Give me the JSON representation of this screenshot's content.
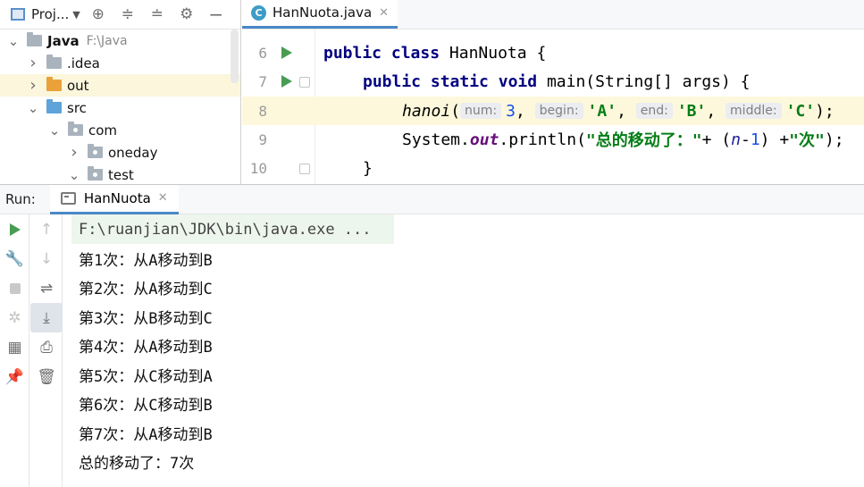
{
  "project": {
    "title": "Proj...",
    "tree": [
      {
        "label": "Java",
        "path": "F:\\Java",
        "bold": true,
        "chevron": "down",
        "folder": "grey",
        "level": 0
      },
      {
        "label": ".idea",
        "path": "",
        "chevron": "right",
        "folder": "grey",
        "level": 1
      },
      {
        "label": "out",
        "path": "",
        "chevron": "right",
        "folder": "orange",
        "level": 1,
        "highlight": true
      },
      {
        "label": "src",
        "path": "",
        "chevron": "down",
        "folder": "blue",
        "level": 1
      },
      {
        "label": "com",
        "path": "",
        "chevron": "down",
        "folder": "grey-pkg",
        "level": 2
      },
      {
        "label": "oneday",
        "path": "",
        "chevron": "right",
        "folder": "grey-pkg",
        "level": 3
      },
      {
        "label": "test",
        "path": "",
        "chevron": "down",
        "folder": "grey-pkg",
        "level": 3
      }
    ]
  },
  "editor": {
    "tab_label": "HanNuota.java",
    "tab_icon": "java-class-icon",
    "line_numbers": [
      "6",
      "7",
      "8",
      "9",
      "10"
    ],
    "code": {
      "l6": {
        "kw1": "public",
        "kw2": "class",
        "name": "HanNuota",
        "rest": " {"
      },
      "l7": {
        "kw1": "public",
        "kw2": "static",
        "kw3": "void",
        "rest": " main(String[] args) {"
      },
      "l8": {
        "method": "hanoi",
        "open": "(",
        "hint_num": "num:",
        "num": "3",
        "hint_begin": "begin:",
        "a": "'A'",
        "hint_end": "end:",
        "b": "'B'",
        "hint_middle": "middle:",
        "c": "'C'",
        "close": ");"
      },
      "l9": {
        "sys": "System.",
        "out": "out",
        "println": ".println(",
        "s1": "\"总的移动了：\"",
        "plus": "+ (",
        "n": "n",
        "minus": "-",
        "one": "1",
        "paren": ") +",
        "s2": "\"次\"",
        "end": ");"
      },
      "l10": {
        "brace": "}"
      }
    }
  },
  "run": {
    "label": "Run:",
    "tab_label": "HanNuota",
    "command": "F:\\ruanjian\\JDK\\bin\\java.exe ...",
    "output": [
      "第1次：从A移动到B",
      "第2次：从A移动到C",
      "第3次：从B移动到C",
      "第4次：从A移动到B",
      "第5次：从C移动到A",
      "第6次：从C移动到B",
      "第7次：从A移动到B",
      "总的移动了：7次"
    ]
  },
  "colors": {
    "keyword": "#000080",
    "string": "#067d17",
    "number": "#1750eb",
    "run_green": "#499c54",
    "tab_underline": "#4a88c7",
    "current_line": "#fdf8dc"
  }
}
